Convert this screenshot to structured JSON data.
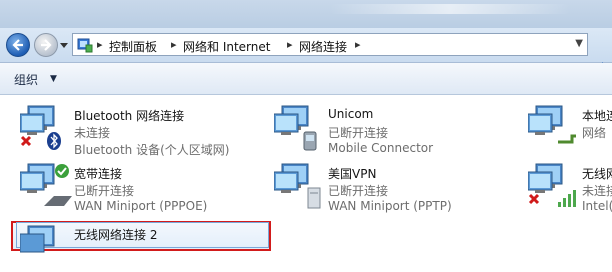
{
  "address_bar": {
    "breadcrumbs": [
      "控制面板",
      "网络和 Internet",
      "网络连接"
    ]
  },
  "toolbar": {
    "organize_label": "组织"
  },
  "connections": [
    {
      "name": "Bluetooth 网络连接",
      "status": "未连接",
      "device": "Bluetooth 设备(个人区域网)"
    },
    {
      "name": "Unicom",
      "status": "已断开连接",
      "device": "Mobile Connector"
    },
    {
      "name": "本地连",
      "status": "网络",
      "device": ""
    },
    {
      "name": "宽带连接",
      "status": "已断开连接",
      "device": "WAN Miniport (PPPOE)"
    },
    {
      "name": "美国VPN",
      "status": "已断开连接",
      "device": "WAN Miniport (PPTP)"
    },
    {
      "name": "无线网",
      "status": "未连接",
      "device": "Intel("
    },
    {
      "name": "无线网络连接 2",
      "status": "",
      "device": ""
    }
  ],
  "colors": {
    "highlight_border": "#d21b1b",
    "header_gradient": "#c9dbef"
  },
  "icons": [
    "back-arrow-icon",
    "forward-arrow-icon",
    "control-panel-icon",
    "network-monitor-icon",
    "bluetooth-icon",
    "error-x-icon",
    "check-icon",
    "phone-icon",
    "signal-bars-icon"
  ]
}
